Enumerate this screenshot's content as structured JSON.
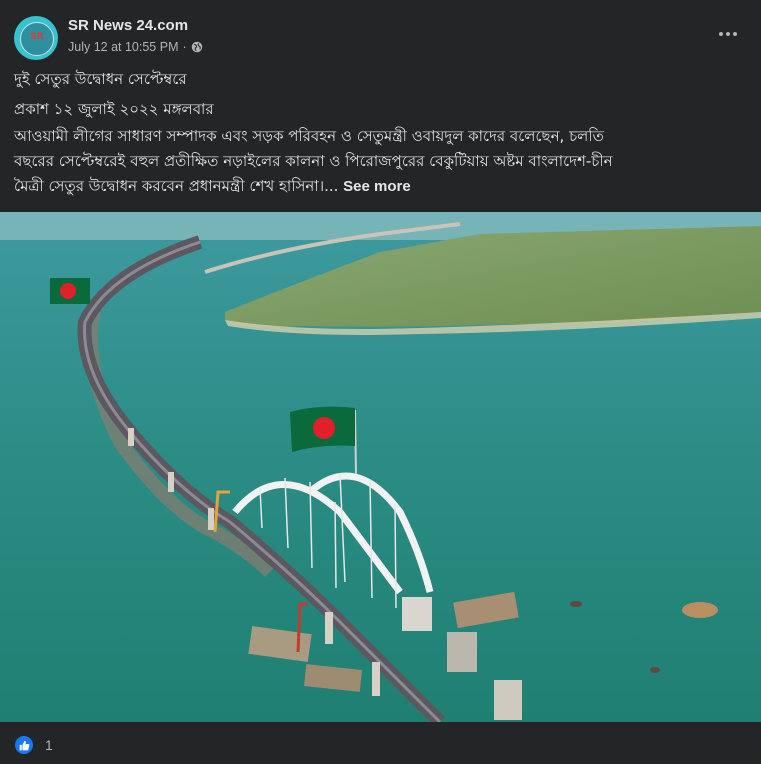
{
  "post": {
    "page_name": "SR News 24.com",
    "timestamp": "July 12 at 10:55 PM",
    "separator": "·",
    "privacy_icon": "globe-icon",
    "avatar_text": "SR",
    "headline": "দুই সেতুর উদ্বোধন সেপ্টেম্বরে",
    "published_line": "প্রকাশ ১২ জুলাই ২০২২ মঙ্গলবার",
    "body_lines": [
      "আওয়ামী লীগের সাধারণ সম্পাদক এবং সড়ক পরিবহন ও সেতুমন্ত্রী ওবায়দুল কাদের বলেছেন, চলতি",
      "বছরের সেপ্টেম্বরেই বহুল প্রতীক্ষিত নড়াইলের কালনা ও পিরোজপুরের বেকুটিয়ায় অষ্টম বাংলাদেশ-চীন",
      "মৈত্রী সেতুর উদ্বোধন করবেন প্রধানমন্ত্রী শেখ হাসিনা।..."
    ],
    "see_more": "See more",
    "more_options_icon": "more-horizontal-icon"
  },
  "reactions": {
    "icon": "like-icon",
    "count": "1"
  },
  "colors": {
    "background": "#242526",
    "text_primary": "#e4e6eb",
    "text_secondary": "#b0b3b8",
    "like_blue": "#1877f2",
    "water": "#2b8c86",
    "flag_green": "#0a6a3b",
    "flag_red": "#e2202c"
  }
}
